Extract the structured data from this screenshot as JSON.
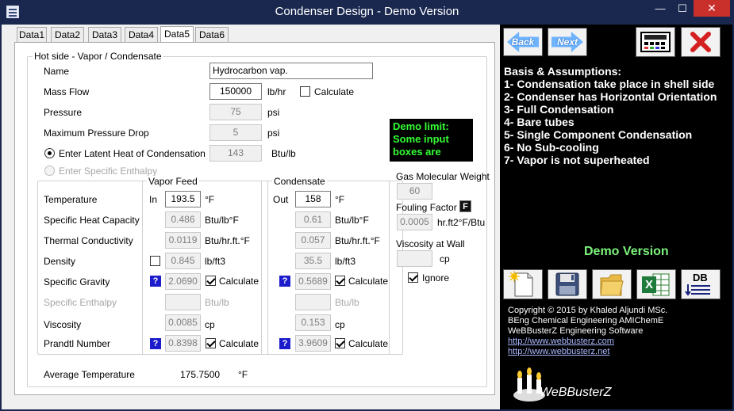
{
  "window": {
    "title": "Condenser Design - Demo Version",
    "minimize": "—",
    "maximize": "☐",
    "close": "✕"
  },
  "tabs": [
    "Data1",
    "Data2",
    "Data3",
    "Data4",
    "Data5",
    "Data6"
  ],
  "active_tab": "Data5",
  "hot_side": {
    "title": "Hot side - Vapor / Condensate",
    "name_label": "Name",
    "name_value": "Hydrocarbon vap.",
    "mass_flow_label": "Mass Flow",
    "mass_flow_value": "150000",
    "mass_flow_unit": "lb/hr",
    "calculate_label": "Calculate",
    "pressure_label": "Pressure",
    "pressure_value": "75",
    "pressure_unit": "psi",
    "max_dp_label": "Maximum Pressure Drop",
    "max_dp_value": "5",
    "max_dp_unit": "psi",
    "latent_label": "Enter Latent Heat of Condensation",
    "latent_value": "143",
    "latent_unit": "Btu/lb",
    "enthalpy_label": "Enter Specific Enthalpy"
  },
  "demo_limit": {
    "line1": "Demo limit:",
    "line2": "Some input",
    "line3": "boxes are"
  },
  "properties": {
    "labels": {
      "temperature": "Temperature",
      "cp": "Specific Heat Capacity",
      "k": "Thermal Conductivity",
      "density": "Density",
      "sg": "Specific Gravity",
      "h": "Specific Enthalpy",
      "visc": "Viscosity",
      "pr": "Prandtl Number"
    },
    "vapor": {
      "title": "Vapor Feed",
      "in_label": "In",
      "temperature": "193.5",
      "temp_unit": "°F",
      "cp": "0.486",
      "cp_unit": "Btu/lb°F",
      "k": "0.0119",
      "k_unit": "Btu/hr.ft.°F",
      "density": "0.845",
      "density_unit": "lb/ft3",
      "sg": "2.0690",
      "h": "",
      "h_unit": "Btu/lb",
      "visc": "0.0085",
      "visc_unit": "cp",
      "pr": "0.8398",
      "calculate": "Calculate"
    },
    "condensate": {
      "title": "Condensate",
      "out_label": "Out",
      "temperature": "158",
      "temp_unit": "°F",
      "cp": "0.61",
      "cp_unit": "Btu/lb°F",
      "k": "0.057",
      "k_unit": "Btu/hr.ft.°F",
      "density": "35.5",
      "density_unit": "lb/ft3",
      "sg": "0.5689",
      "h": "",
      "h_unit": "Btu/lb",
      "visc": "0.153",
      "visc_unit": "cp",
      "pr": "3.9609",
      "calculate": "Calculate"
    },
    "help": "?"
  },
  "extra": {
    "gas_mw_label": "Gas Molecular Weight",
    "gas_mw_value": "60",
    "fouling_label": "Fouling Factor",
    "fouling_button": "F",
    "fouling_value": "0.0005",
    "fouling_unit": "hr.ft2°F/Btu",
    "visc_wall_label": "Viscosity at Wall",
    "visc_wall_value": "",
    "visc_wall_unit": "cp",
    "ignore_label": "Ignore"
  },
  "avg_temp": {
    "label": "Average Temperature",
    "value": "175.7500",
    "unit": "°F"
  },
  "right": {
    "back": "Back",
    "next": "Next",
    "basis_title": "Basis & Assumptions:",
    "basis": [
      "1- Condensation take place in shell side",
      "2- Condenser has Horizontal Orientation",
      "3- Full Condensation",
      "4- Bare tubes",
      "5- Single Component Condensation",
      "6- No Sub-cooling",
      "7- Vapor is not superheated"
    ],
    "demo_version": "Demo Version",
    "db_label": "DB",
    "excel_label": "X",
    "copyright": [
      "Copyright © 2015 by Khaled Aljundi MSc.",
      "BEng Chemical Engineering AMIChemE",
      "WeBBusterZ Engineering Software"
    ],
    "links": [
      "http://www.webbusterz.com",
      "http://www.webbusterz.net"
    ],
    "logo_text": "WeBBusterZ"
  }
}
